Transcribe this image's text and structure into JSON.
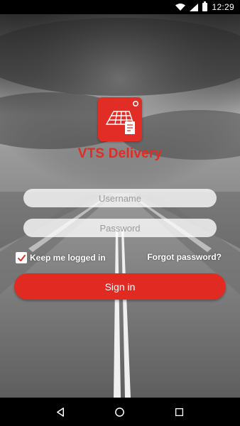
{
  "status_bar": {
    "time": "12:29",
    "icons": [
      "wifi-icon",
      "signal-icon",
      "battery-icon"
    ]
  },
  "app": {
    "title": "VTS Delivery",
    "logo_icon": "vts-delivery-logo",
    "brand_color": "#e12d25"
  },
  "login": {
    "username_placeholder": "Username",
    "username_value": "",
    "password_placeholder": "Password",
    "password_value": "",
    "keep_logged_in_label": "Keep me logged in",
    "keep_logged_in_checked": true,
    "forgot_password_label": "Forgot password?",
    "signin_label": "Sign in"
  },
  "nav_bar": {
    "icons": [
      "back-icon",
      "home-icon",
      "recents-icon"
    ]
  }
}
